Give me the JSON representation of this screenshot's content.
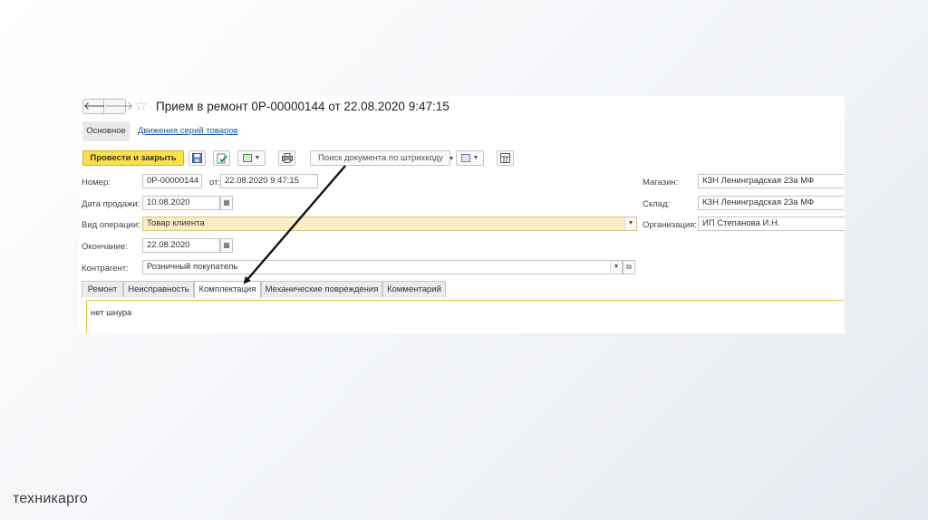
{
  "window": {
    "title": "Прием в ремонт 0Р-00000144 от 22.08.2020 9:47:15",
    "nav_back_glyph": "🡐",
    "nav_forward_glyph": "🡒",
    "star_glyph": "☆"
  },
  "section_tabs": {
    "main": "Основное",
    "link": "Движения серий товаров"
  },
  "toolbar": {
    "post_and_close": "Провести и закрыть",
    "barcode_search": "Поиск документа по штрихкоду"
  },
  "form": {
    "number": {
      "label": "Номер:",
      "value": "0Р-00000144"
    },
    "from": {
      "label": "от:",
      "value": "22.08.2020  9:47:15"
    },
    "sale_date": {
      "label": "Дата продажи:",
      "value": "10.08.2020"
    },
    "operation": {
      "label": "Вид операции:",
      "value": "Товар клиента"
    },
    "end": {
      "label": "Окончание:",
      "value": "22.08.2020"
    },
    "counterparty": {
      "label": "Контрагент:",
      "value": "Розничный покупатель"
    },
    "store": {
      "label": "Магазин:",
      "value": "КЗН Ленинградская 23а МФ"
    },
    "warehouse": {
      "label": "Склад:",
      "value": "КЗН Ленинградская 23а МФ"
    },
    "organization": {
      "label": "Организация:",
      "value": "ИП Степанова И.Н."
    }
  },
  "form_tabs": [
    {
      "label": "Ремонт",
      "active": false
    },
    {
      "label": "Неисправность",
      "active": false
    },
    {
      "label": "Комплектация",
      "active": true
    },
    {
      "label": "Механические повреждения",
      "active": false
    },
    {
      "label": "Комментарий",
      "active": false
    }
  ],
  "tab_content": {
    "text": "нет шнура"
  },
  "colors": {
    "accent_yellow": "#fbe04d",
    "field_highlight": "#fbeec2",
    "link_blue": "#1a56a8"
  },
  "footer": {
    "logo": "техникаpro"
  }
}
